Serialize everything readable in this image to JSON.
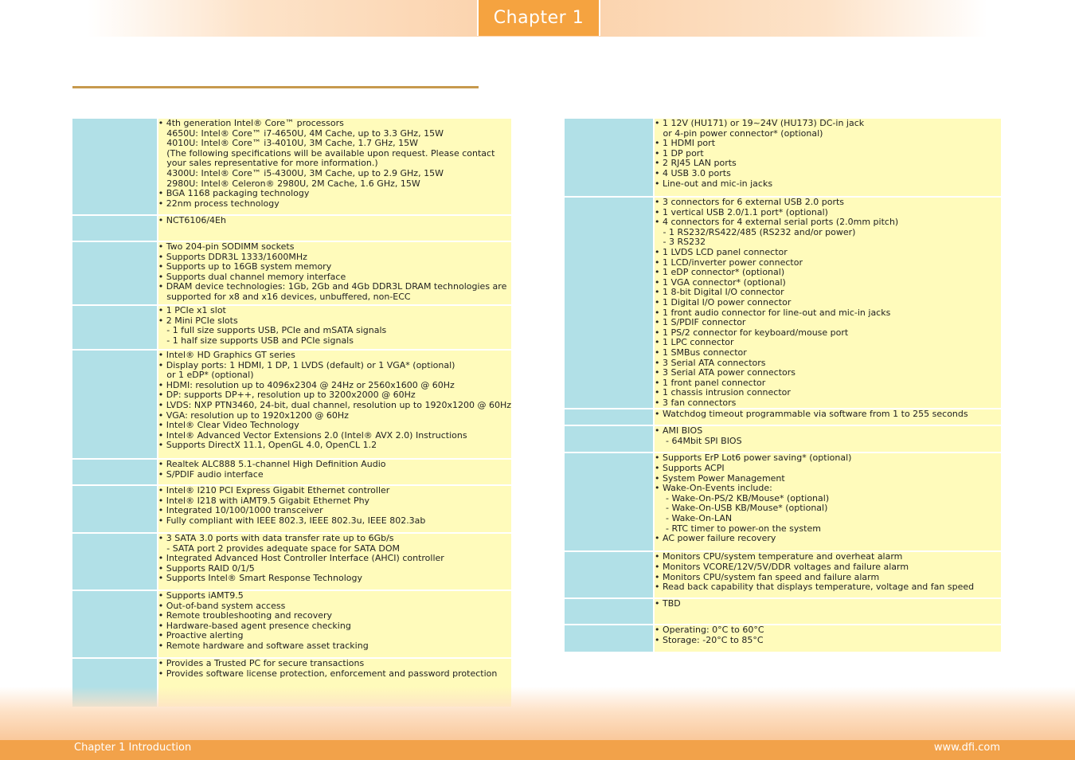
{
  "header": {
    "chapter_tab": "Chapter 1"
  },
  "footer": {
    "left": "Chapter 1 Introduction",
    "right": "www.dfi.com"
  },
  "left_table": [
    {
      "lines": [
        "• 4th generation Intel® Core™ processors",
        "   4650U: Intel® Core™ i7-4650U, 4M Cache, up to 3.3 GHz, 15W",
        "   4010U: Intel® Core™ i3-4010U, 3M Cache, 1.7 GHz, 15W",
        "   (The following specifications will be available upon request. Please contact",
        "   your sales representative for more information.)",
        "   4300U: Intel® Core™ i5-4300U, 3M Cache, up to 2.9 GHz, 15W",
        "   2980U: Intel® Celeron® 2980U, 2M Cache, 1.6 GHz, 15W",
        "• BGA 1168 packaging technology",
        "• 22nm process technology"
      ]
    },
    {
      "lines": [
        "• NCT6106/4Eh"
      ]
    },
    {
      "lines": [
        "• Two 204-pin SODIMM sockets",
        "• Supports DDR3L 1333/1600MHz",
        "• Supports up to 16GB system memory",
        "• Supports dual channel memory interface",
        "• DRAM device technologies: 1Gb, 2Gb and 4Gb DDR3L DRAM technologies are",
        "   supported for x8 and x16 devices, unbuffered, non-ECC"
      ]
    },
    {
      "lines": [
        "• 1 PCIe x1 slot",
        "• 2 Mini PCIe slots",
        "   - 1 full size supports USB, PCIe and mSATA signals",
        "   - 1 half size supports USB and PCIe signals"
      ]
    },
    {
      "lines": [
        "• Intel® HD Graphics GT series",
        "• Display ports: 1 HDMI, 1 DP, 1 LVDS (default) or 1 VGA* (optional)",
        "   or 1 eDP* (optional)",
        "• HDMI: resolution up to 4096x2304 @ 24Hz or 2560x1600 @ 60Hz",
        "• DP: supports DP++, resolution up to 3200x2000 @ 60Hz",
        "• LVDS: NXP PTN3460, 24-bit, dual channel, resolution up to 1920x1200 @ 60Hz",
        "• VGA: resolution up to 1920x1200 @ 60Hz",
        "• Intel® Clear Video Technology",
        "• Intel® Advanced Vector Extensions 2.0 (Intel® AVX 2.0) Instructions",
        "• Supports DirectX 11.1, OpenGL 4.0, OpenCL 1.2"
      ]
    },
    {
      "lines": [
        "• Realtek ALC888 5.1-channel High Definition Audio",
        "• S/PDIF audio interface"
      ]
    },
    {
      "lines": [
        "• Intel® I210 PCI Express Gigabit Ethernet controller",
        "• Intel® I218 with iAMT9.5 Gigabit Ethernet Phy",
        "• Integrated 10/100/1000 transceiver",
        "• Fully compliant with IEEE 802.3, IEEE 802.3u, IEEE 802.3ab"
      ]
    },
    {
      "lines": [
        "• 3 SATA 3.0 ports with data transfer rate up to 6Gb/s",
        "   - SATA port 2 provides adequate space for SATA DOM",
        "• Integrated Advanced Host Controller Interface (AHCI) controller",
        "• Supports RAID 0/1/5",
        "• Supports Intel® Smart Response Technology"
      ]
    },
    {
      "lines": [
        "• Supports iAMT9.5",
        "• Out-of-band system access",
        "• Remote troubleshooting and recovery",
        "• Hardware-based agent presence checking",
        "• Proactive alerting",
        "• Remote hardware and software asset tracking"
      ]
    },
    {
      "lines": [
        "• Provides a Trusted PC for secure transactions",
        "• Provides software license protection, enforcement and password protection"
      ]
    }
  ],
  "right_table": [
    {
      "lines": [
        "• 1 12V (HU171) or 19~24V (HU173) DC-in jack",
        "   or 4-pin power connector* (optional)",
        "• 1 HDMI port",
        "• 1 DP port",
        "• 2 RJ45 LAN ports",
        "• 4 USB 3.0 ports",
        "• Line-out and mic-in jacks"
      ]
    },
    {
      "lines": [
        "• 3 connectors for 6 external USB 2.0 ports",
        "• 1 vertical USB 2.0/1.1 port* (optional)",
        "• 4 connectors for 4 external serial ports (2.0mm pitch)",
        "   - 1 RS232/RS422/485 (RS232 and/or power)",
        "   - 3 RS232",
        "• 1 LVDS LCD panel connector",
        "• 1 LCD/inverter power connector",
        "• 1 eDP connector* (optional)",
        "• 1 VGA connector* (optional)",
        "• 1 8-bit Digital I/O connector",
        "• 1 Digital I/O power connector",
        "• 1 front audio connector for line-out and mic-in jacks",
        "• 1 S/PDIF connector",
        "• 1 PS/2 connector for keyboard/mouse port",
        "• 1 LPC connector",
        "• 1 SMBus connector",
        "• 3 Serial ATA connectors",
        "• 3 Serial ATA power connectors",
        "• 1 front panel connector",
        "• 1 chassis intrusion connector",
        "• 3 fan connectors"
      ]
    },
    {
      "lines": [
        "• Watchdog timeout programmable via software from 1 to 255 seconds"
      ]
    },
    {
      "lines": [
        "• AMI BIOS",
        "    - 64Mbit SPI BIOS"
      ]
    },
    {
      "lines": [
        "• Supports ErP Lot6 power saving* (optional)",
        "• Supports ACPI",
        "• System Power Management",
        "• Wake-On-Events include:",
        "    - Wake-On-PS/2 KB/Mouse* (optional)",
        "    - Wake-On-USB KB/Mouse* (optional)",
        "    - Wake-On-LAN",
        "    - RTC timer to power-on the system",
        "• AC power failure recovery"
      ]
    },
    {
      "lines": [
        "• Monitors CPU/system temperature and overheat alarm",
        "• Monitors VCORE/12V/5V/DDR voltages and failure alarm",
        "• Monitors CPU/system fan speed and failure alarm",
        "• Read back capability that displays temperature, voltage and fan speed"
      ]
    },
    {
      "lines": [
        "• TBD"
      ]
    },
    {
      "lines": [
        "• Operating: 0°C to 60°C",
        "• Storage: -20°C to 85°C"
      ]
    }
  ]
}
